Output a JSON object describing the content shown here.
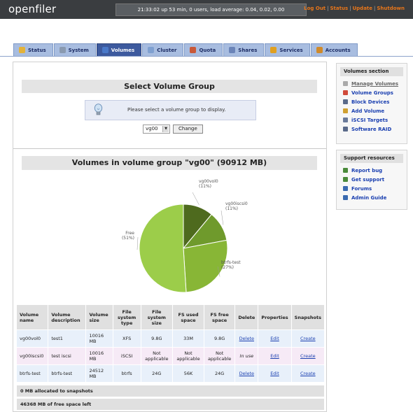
{
  "app": {
    "logo": "openfiler"
  },
  "topbar": {
    "uptime": "21:33:02 up 53 min, 0 users, load average: 0.04, 0.02, 0.00",
    "links": [
      "Log Out",
      "Status",
      "Update",
      "Shutdown"
    ],
    "separator": "|"
  },
  "tabs": [
    {
      "label": "Status",
      "icon": "status-icon",
      "color": "#e3b23a"
    },
    {
      "label": "System",
      "icon": "system-icon",
      "color": "#8a9ab0"
    },
    {
      "label": "Volumes",
      "icon": "volumes-icon",
      "color": "#4a79c9",
      "active": true
    },
    {
      "label": "Cluster",
      "icon": "cluster-icon",
      "color": "#7fa0d0"
    },
    {
      "label": "Quota",
      "icon": "quota-icon",
      "color": "#c9593a"
    },
    {
      "label": "Shares",
      "icon": "shares-icon",
      "color": "#6b84b8"
    },
    {
      "label": "Services",
      "icon": "services-icon",
      "color": "#e0a020"
    },
    {
      "label": "Accounts",
      "icon": "accounts-icon",
      "color": "#d08a2a"
    }
  ],
  "select_group": {
    "title": "Select Volume Group",
    "notice": "Please select a volume group to display.",
    "selected": "vg00",
    "change_label": "Change"
  },
  "volumes": {
    "title": "Volumes in volume group \"vg00\" (90912 MB)",
    "columns": [
      "Volume name",
      "Volume description",
      "Volume size",
      "File system type",
      "File system size",
      "FS used space",
      "FS free space",
      "Delete",
      "Properties",
      "Snapshots"
    ],
    "rows": [
      {
        "name": "vg00vol0",
        "desc": "test1",
        "size": "10016 MB",
        "fstype": "XFS",
        "fssize": "9.8G",
        "used": "33M",
        "free": "9.8G",
        "delete": "Delete",
        "delete_link": true,
        "props": "Edit",
        "snap": "Create"
      },
      {
        "name": "vg00iscsi0",
        "desc": "test iscsi",
        "size": "10016 MB",
        "fstype": "iSCSI",
        "fssize": "Not applicable",
        "used": "Not applicable",
        "free": "Not applicable",
        "delete": "In use",
        "delete_link": false,
        "props": "Edit",
        "snap": "Create"
      },
      {
        "name": "btrfs-test",
        "desc": "btrfs-test",
        "size": "24512 MB",
        "fstype": "btrfs",
        "fssize": "24G",
        "used": "56K",
        "free": "24G",
        "delete": "Delete",
        "delete_link": true,
        "props": "Edit",
        "snap": "Create"
      }
    ],
    "summary_snapshots": "0 MB allocated to snapshots",
    "summary_free": "46368 MB of free space left"
  },
  "chart_data": {
    "type": "pie",
    "slices": [
      {
        "label": "vg00vol0",
        "pct_label": "(11%)",
        "value": 10016,
        "color": "#4e6a1e"
      },
      {
        "label": "vg00iscsi0",
        "pct_label": "(11%)",
        "value": 10016,
        "color": "#6f9a2c"
      },
      {
        "label": "btrfs-test",
        "pct_label": "(27%)",
        "value": 24512,
        "color": "#88b636"
      },
      {
        "label": "Free",
        "pct_label": "(51%)",
        "value": 46368,
        "color": "#9ccd4a"
      }
    ]
  },
  "sidebar": {
    "volumes_title": "Volumes section",
    "volumes_items": [
      {
        "label": "Manage Volumes",
        "icon": "manage-volumes-icon",
        "color": "#aaaaaa",
        "current": true
      },
      {
        "label": "Volume Groups",
        "icon": "volume-groups-icon",
        "color": "#d04a3a"
      },
      {
        "label": "Block Devices",
        "icon": "block-devices-icon",
        "color": "#5a6a8a"
      },
      {
        "label": "Add Volume",
        "icon": "add-volume-icon",
        "color": "#d0a030"
      },
      {
        "label": "iSCSI Targets",
        "icon": "iscsi-targets-icon",
        "color": "#6a7a9a"
      },
      {
        "label": "Software RAID",
        "icon": "software-raid-icon",
        "color": "#5a6a8a"
      }
    ],
    "support_title": "Support resources",
    "support_items": [
      {
        "label": "Report bug",
        "icon": "report-bug-icon",
        "color": "#4a8a3a"
      },
      {
        "label": "Get support",
        "icon": "get-support-icon",
        "color": "#4a8a3a"
      },
      {
        "label": "Forums",
        "icon": "forums-icon",
        "color": "#3a6ab0"
      },
      {
        "label": "Admin Guide",
        "icon": "admin-guide-icon",
        "color": "#3a6ab0"
      }
    ]
  }
}
